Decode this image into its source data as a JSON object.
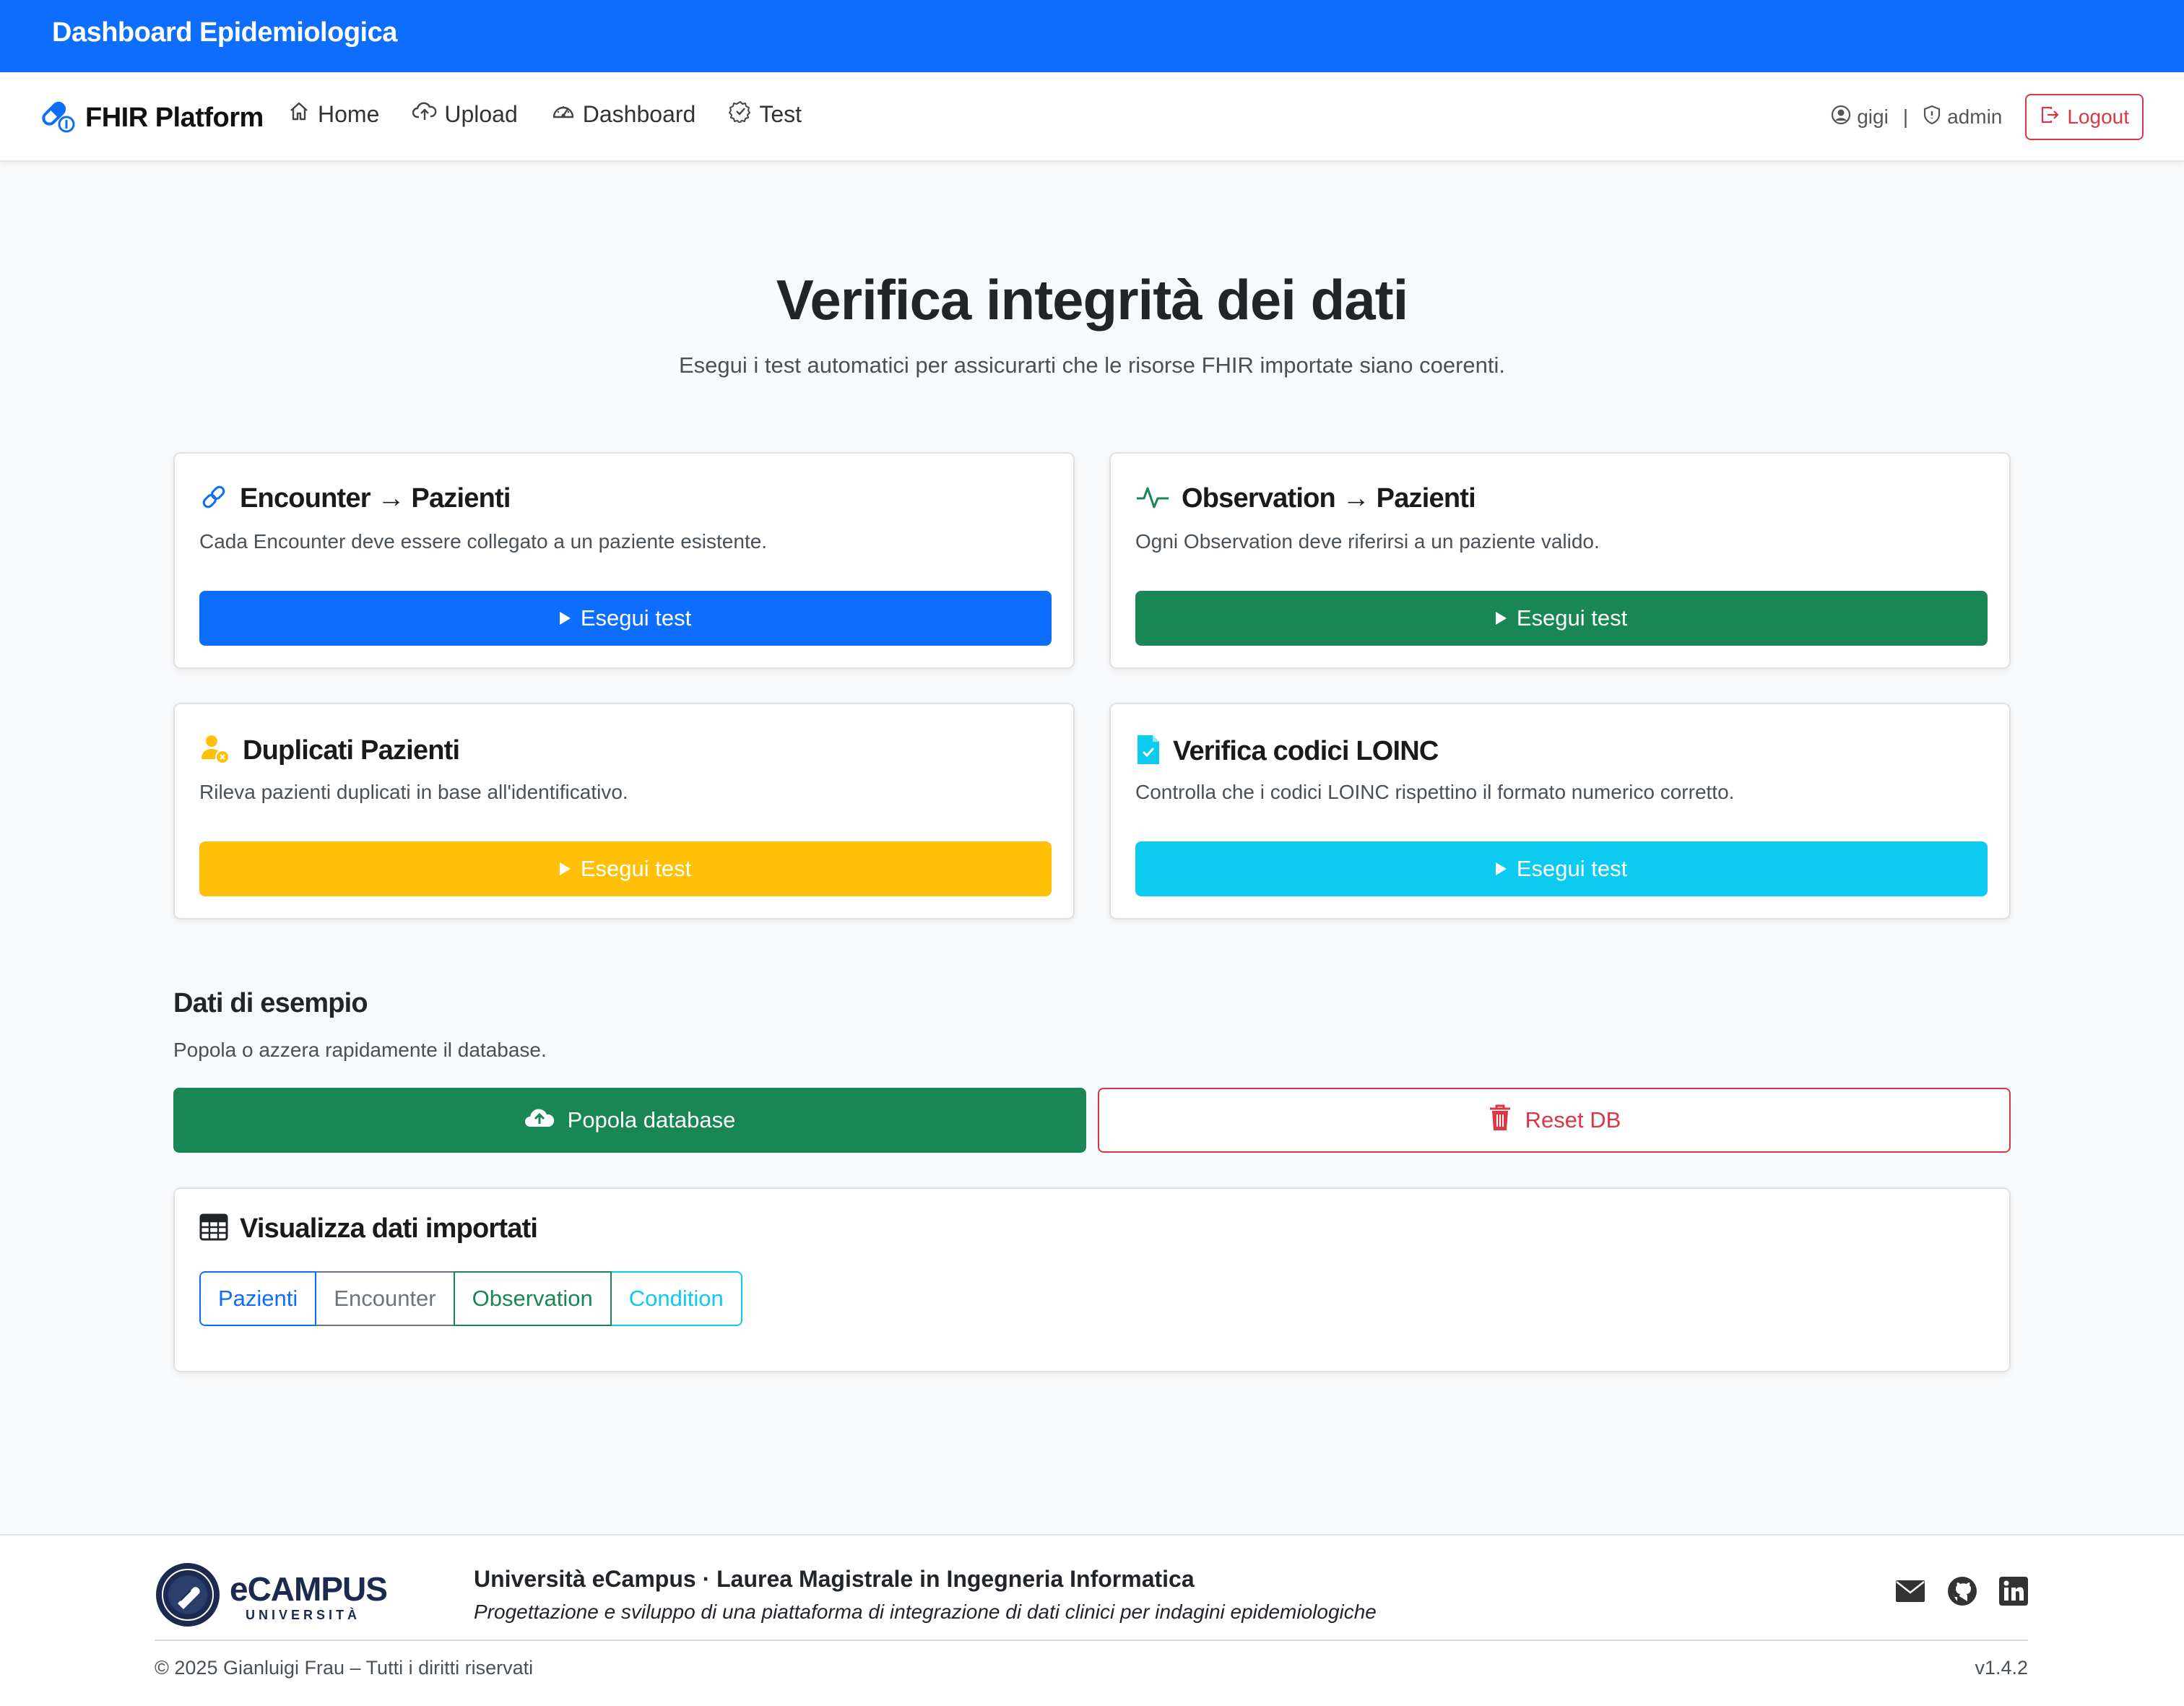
{
  "topbar": {
    "title": "Dashboard Epidemiologica"
  },
  "navbar": {
    "brand": "FHIR Platform",
    "items": [
      {
        "label": "Home",
        "icon": "home-icon"
      },
      {
        "label": "Upload",
        "icon": "cloud-upload-icon"
      },
      {
        "label": "Dashboard",
        "icon": "speedometer-icon"
      },
      {
        "label": "Test",
        "icon": "patch-check-icon"
      }
    ],
    "user": "gigi",
    "separator": "|",
    "role": "admin",
    "logout_label": "Logout"
  },
  "page": {
    "title": "Verifica integrità dei dati",
    "subtitle": "Esegui i test automatici per assicurarti che le risorse FHIR importate siano coerenti."
  },
  "tests": [
    {
      "title": "Encounter → Pazienti",
      "description": "Cada Encounter deve essere collegato a un paziente esistente.",
      "button": "Esegui test",
      "icon": "link-icon",
      "color": "#0d6efd"
    },
    {
      "title": "Observation → Pazienti",
      "description": "Ogni Observation deve riferirsi a un paziente valido.",
      "button": "Esegui test",
      "icon": "activity-icon",
      "color": "#198754"
    },
    {
      "title": "Duplicati Pazienti",
      "description": "Rileva pazienti duplicati in base all'identificativo.",
      "button": "Esegui test",
      "icon": "person-duplicate-icon",
      "color": "#ffc107"
    },
    {
      "title": "Verifica codici LOINC",
      "description": "Controlla che i codici LOINC rispettino il formato numerico corretto.",
      "button": "Esegui test",
      "icon": "file-check-icon",
      "color": "#0dcaf0"
    }
  ],
  "sample_data": {
    "title": "Dati di esempio",
    "description": "Popola o azzera rapidamente il database.",
    "populate_label": "Popola database",
    "reset_label": "Reset DB"
  },
  "imported": {
    "title": "Visualizza dati importati",
    "tabs": [
      {
        "label": "Pazienti",
        "color": "#0d6efd"
      },
      {
        "label": "Encounter",
        "color": "#6c757d"
      },
      {
        "label": "Observation",
        "color": "#198754"
      },
      {
        "label": "Condition",
        "color": "#0dcaf0"
      }
    ]
  },
  "footer": {
    "logo_main": "eCAMPUS",
    "logo_sub": "UNIVERSITÀ",
    "title": "Università eCampus · Laurea Magistrale in Ingegneria Informatica",
    "subtitle": "Progettazione e sviluppo di una piattaforma di integrazione di dati clinici per indagini epidemiologiche",
    "copyright": "© 2025 Gianluigi Frau – Tutti i diritti riservati",
    "version": "v1.4.2",
    "icons": [
      "envelope-icon",
      "github-icon",
      "linkedin-icon"
    ]
  }
}
